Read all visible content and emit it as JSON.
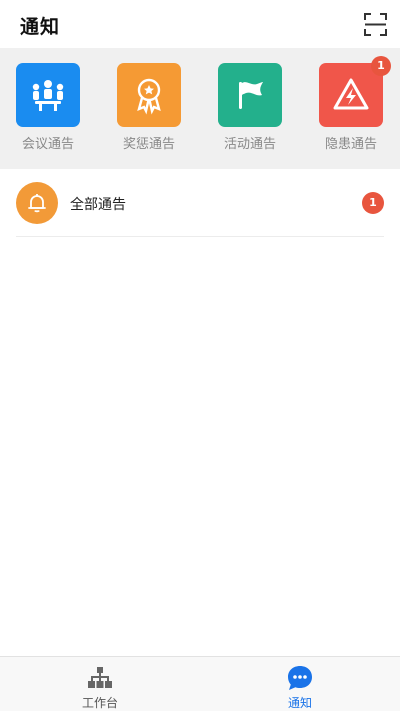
{
  "header": {
    "title": "通知"
  },
  "categories": [
    {
      "label": "会议通告",
      "icon": "meeting-icon",
      "color": "#1a8cf0"
    },
    {
      "label": "奖惩通告",
      "icon": "award-ribbon-icon",
      "color": "#f59a34"
    },
    {
      "label": "活动通告",
      "icon": "flag-icon",
      "color": "#23b08c"
    },
    {
      "label": "隐患通告",
      "icon": "hazard-warning-icon",
      "color": "#f0564a",
      "badge": "1"
    }
  ],
  "notice": {
    "label": "全部通告",
    "icon": "bell-icon",
    "color": "#f29a38",
    "count": "1"
  },
  "tabbar": {
    "items": [
      {
        "label": "工作台",
        "icon": "workbench-icon",
        "active": false
      },
      {
        "label": "通知",
        "icon": "chat-bubble-icon",
        "active": true,
        "active_color": "#1a73e8"
      }
    ]
  }
}
